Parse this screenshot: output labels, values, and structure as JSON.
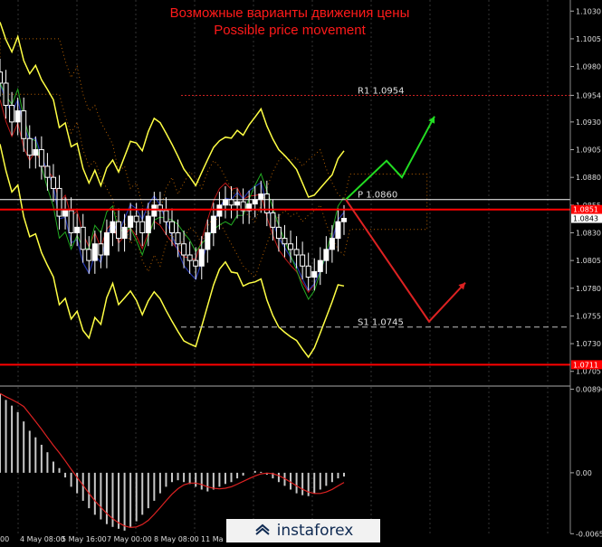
{
  "header": {
    "title_ru": "Возможные варианты движения цены",
    "title_en": "Possible price movement"
  },
  "logo": {
    "text": "instaforex"
  },
  "price_axis": {
    "ticks": [
      "1.1030",
      "1.1005",
      "1.0980",
      "1.0954",
      "1.0930",
      "1.0905",
      "1.0880",
      "1.0855",
      "1.0830",
      "1.0805",
      "1.0780",
      "1.0755",
      "1.0730",
      "1.0705"
    ]
  },
  "osc_axis": {
    "ticks": [
      "0.00896",
      "0.00",
      "-0.00653"
    ]
  },
  "time_axis": {
    "labels": [
      "00",
      "4 May 08:00",
      "5 May 16:00",
      "7 May 00:00",
      "8 May 08:00",
      "11 Ma"
    ]
  },
  "levels": [
    {
      "key": "R1",
      "label": "R1 1.0954",
      "value": 1.0954,
      "color": "#cc2222",
      "style": "dotted"
    },
    {
      "key": "P",
      "label": "P 1.0860",
      "value": 1.086,
      "color": "#ffffff",
      "style": "solid"
    },
    {
      "key": "S1",
      "label": "S1 1.0745",
      "value": 1.0745,
      "color": "#c0c0c0",
      "style": "dashed"
    }
  ],
  "price_tags": [
    {
      "label": "1.0851",
      "value": 1.0851,
      "color": "#ff0000"
    },
    {
      "label": "1.0843",
      "value": 1.0843,
      "color": "#ffffff"
    },
    {
      "label": "1.0711",
      "value": 1.0711,
      "color": "#ff0000"
    }
  ],
  "colors": {
    "up_arrow": "#22dd22",
    "down_arrow": "#dd2222",
    "bollinger": "#ffff44",
    "ichimoku": "#ff8800"
  },
  "chart_data": {
    "type": "line",
    "title": "Возможные варианты движения цены / Possible price movement",
    "ylim": [
      1.0695,
      1.104
    ],
    "xlabel": "",
    "ylabel": "",
    "close": [
      1.0965,
      1.0945,
      1.093,
      1.094,
      1.0915,
      1.09,
      1.0905,
      1.089,
      1.088,
      1.087,
      1.0845,
      1.085,
      1.083,
      1.0835,
      1.0815,
      1.0805,
      1.082,
      1.081,
      1.083,
      1.084,
      1.0825,
      1.0835,
      1.0845,
      1.084,
      1.083,
      1.0845,
      1.0855,
      1.085,
      1.084,
      1.083,
      1.082,
      1.081,
      1.0805,
      1.08,
      1.0815,
      1.083,
      1.0845,
      1.0855,
      1.086,
      1.0855,
      1.0858,
      1.085,
      1.0856,
      1.086,
      1.0865,
      1.0848,
      1.0835,
      1.0825,
      1.082,
      1.0815,
      1.081,
      1.08,
      1.079,
      1.0795,
      1.0805,
      1.0815,
      1.0825,
      1.084,
      1.0843
    ],
    "oscillator": [
      0.0085,
      0.0078,
      0.0072,
      0.0065,
      0.0055,
      0.0045,
      0.0038,
      0.003,
      0.0022,
      0.0012,
      0.0005,
      -0.0005,
      -0.0015,
      -0.0022,
      -0.003,
      -0.0038,
      -0.0045,
      -0.005,
      -0.0055,
      -0.0058,
      -0.006,
      -0.0062,
      -0.0058,
      -0.0052,
      -0.0045,
      -0.0038,
      -0.003,
      -0.0022,
      -0.0015,
      -0.001,
      -0.0008,
      -0.001,
      -0.0012,
      -0.0015,
      -0.0018,
      -0.002,
      -0.0018,
      -0.0015,
      -0.0012,
      -0.001,
      -0.0006,
      -0.0003,
      0.0,
      0.0002,
      0.0001,
      -0.0002,
      -0.0006,
      -0.001,
      -0.0014,
      -0.0018,
      -0.0022,
      -0.0024,
      -0.0025,
      -0.0022,
      -0.0018,
      -0.0014,
      -0.001,
      -0.0006,
      -0.0004
    ],
    "scenarios": [
      {
        "name": "up",
        "points": [
          1.086,
          1.0895,
          1.088,
          1.0935
        ]
      },
      {
        "name": "down",
        "points": [
          1.086,
          1.075,
          1.0785
        ]
      }
    ]
  }
}
